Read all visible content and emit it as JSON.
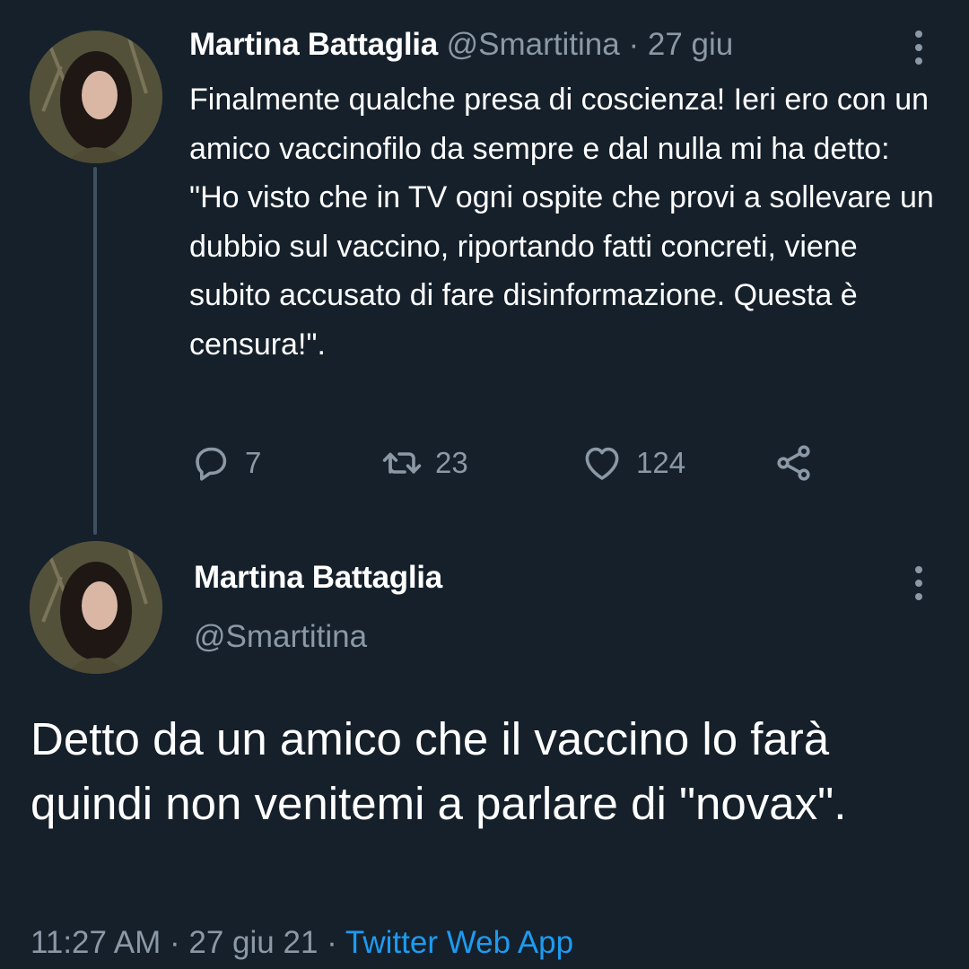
{
  "tweet1": {
    "author_name": "Martina Battaglia",
    "handle": "@Smartitina",
    "separator": "·",
    "date": "27 giu",
    "text": "Finalmente qualche presa di coscienza! Ieri ero con un amico vaccinofilo da sempre e dal nulla mi ha detto: \"Ho visto che in TV ogni ospite che provi a sollevare un dubbio sul vaccino, riportando fatti concreti, viene subito accusato di fare disinformazione. Questa è censura!\".",
    "actions": {
      "reply_icon": "reply-icon",
      "reply_count": "7",
      "retweet_icon": "retweet-icon",
      "retweet_count": "23",
      "like_icon": "heart-icon",
      "like_count": "124",
      "share_icon": "share-icon"
    }
  },
  "tweet2": {
    "author_name": "Martina Battaglia",
    "handle": "@Smartitina",
    "text": "Detto da un amico che il vaccino lo farà quindi non venitemi a parlare di \"novax\".",
    "time": "11:27 AM",
    "separator": "·",
    "date": "27 giu 21",
    "source": "Twitter Web App"
  },
  "colors": {
    "background": "#15202b",
    "text": "#ffffff",
    "muted": "#8b98a5",
    "link": "#1d9bf0"
  }
}
